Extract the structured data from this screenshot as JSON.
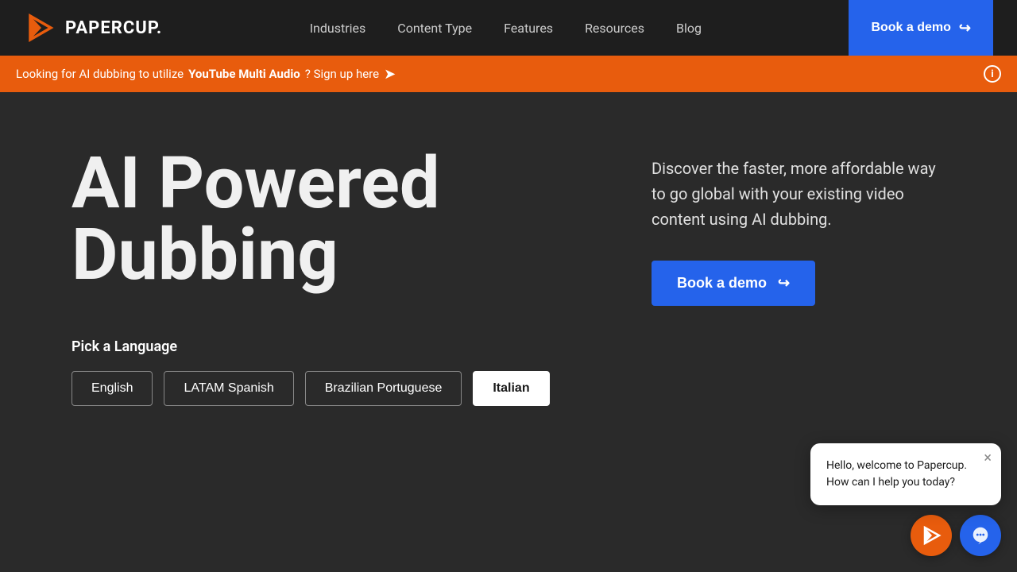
{
  "navbar": {
    "logo_text": "PAPERCUP.",
    "nav_items": [
      {
        "label": "Industries",
        "id": "industries"
      },
      {
        "label": "Content Type",
        "id": "content-type"
      },
      {
        "label": "Features",
        "id": "features"
      },
      {
        "label": "Resources",
        "id": "resources"
      },
      {
        "label": "Blog",
        "id": "blog"
      }
    ],
    "cta_label": "Book a demo"
  },
  "announcement": {
    "prefix": "Looking for AI dubbing to utilize",
    "link_text": "YouTube Multi Audio",
    "suffix": "? Sign up here",
    "arrow": "➤"
  },
  "hero": {
    "title_line1": "AI Powered",
    "title_line2": "Dubbing",
    "description": "Discover the faster, more affordable way to go global with your existing video content using AI dubbing.",
    "cta_label": "Book a demo",
    "pick_language_label": "Pick a Language",
    "languages": [
      {
        "label": "English",
        "active": false
      },
      {
        "label": "LATAM Spanish",
        "active": false
      },
      {
        "label": "Brazilian Portuguese",
        "active": false
      },
      {
        "label": "Italian",
        "active": true
      }
    ]
  },
  "chat": {
    "bubble_text_line1": "Hello, welcome to Papercup.",
    "bubble_text_line2": "How can I help you today?",
    "close_label": "×"
  },
  "icons": {
    "arrow_right": "↪",
    "info": "i"
  }
}
